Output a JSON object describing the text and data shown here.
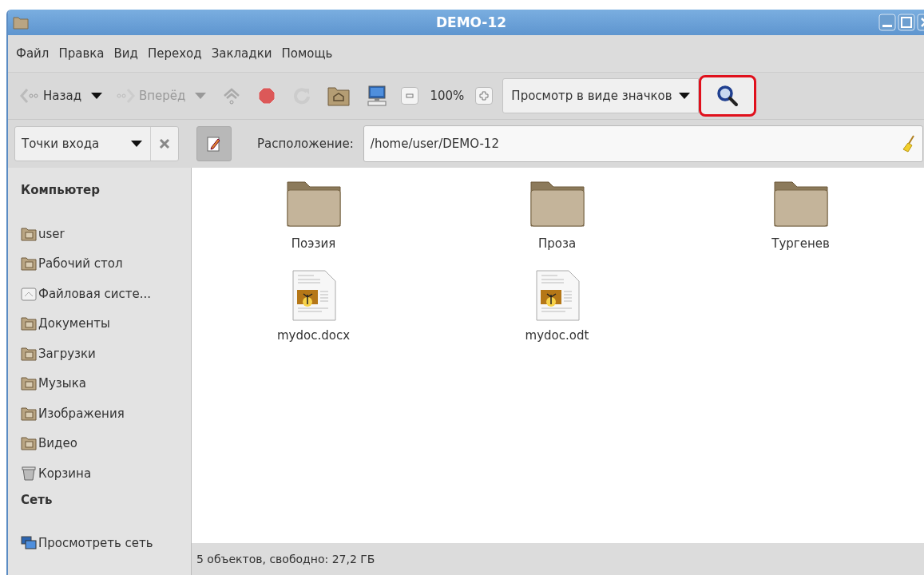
{
  "window": {
    "title": "DEMO-12"
  },
  "menu": [
    "Файл",
    "Правка",
    "Вид",
    "Переход",
    "Закладки",
    "Помощь"
  ],
  "toolbar": {
    "back": {
      "label": "Назад",
      "disabled": false
    },
    "forward": {
      "label": "Вперёд",
      "disabled": true
    },
    "zoom": "100%",
    "view": "Просмотр в виде значков",
    "search": {
      "highlighted": true
    }
  },
  "location_bar": {
    "places": "Точки входа",
    "edit_toggle": {
      "pressed": true
    },
    "label": "Расположение:",
    "path": "/home/user/DEMO-12"
  },
  "sidebar": {
    "sections": [
      {
        "title": "Компьютер",
        "items": [
          {
            "label": "user",
            "kind": "folder"
          },
          {
            "label": "Рабочий стол",
            "kind": "folder"
          },
          {
            "label": "Файловая систе...",
            "kind": "drive"
          },
          {
            "label": "Документы",
            "kind": "folder"
          },
          {
            "label": "Загрузки",
            "kind": "folder"
          },
          {
            "label": "Музыка",
            "kind": "folder"
          },
          {
            "label": "Изображения",
            "kind": "folder"
          },
          {
            "label": "Видео",
            "kind": "folder"
          },
          {
            "label": "Корзина",
            "kind": "trash"
          }
        ]
      },
      {
        "title": "Сеть",
        "items": [
          {
            "label": "Просмотреть сеть",
            "kind": "network"
          }
        ]
      }
    ]
  },
  "files": [
    {
      "name": "Поэзия",
      "kind": "folder"
    },
    {
      "name": "Проза",
      "kind": "folder"
    },
    {
      "name": "Тургенев",
      "kind": "folder"
    },
    {
      "name": "mydoc.docx",
      "kind": "document"
    },
    {
      "name": "mydoc.odt",
      "kind": "document"
    }
  ],
  "status_bar": "5 объектов, свободно: 27,2 ГБ"
}
